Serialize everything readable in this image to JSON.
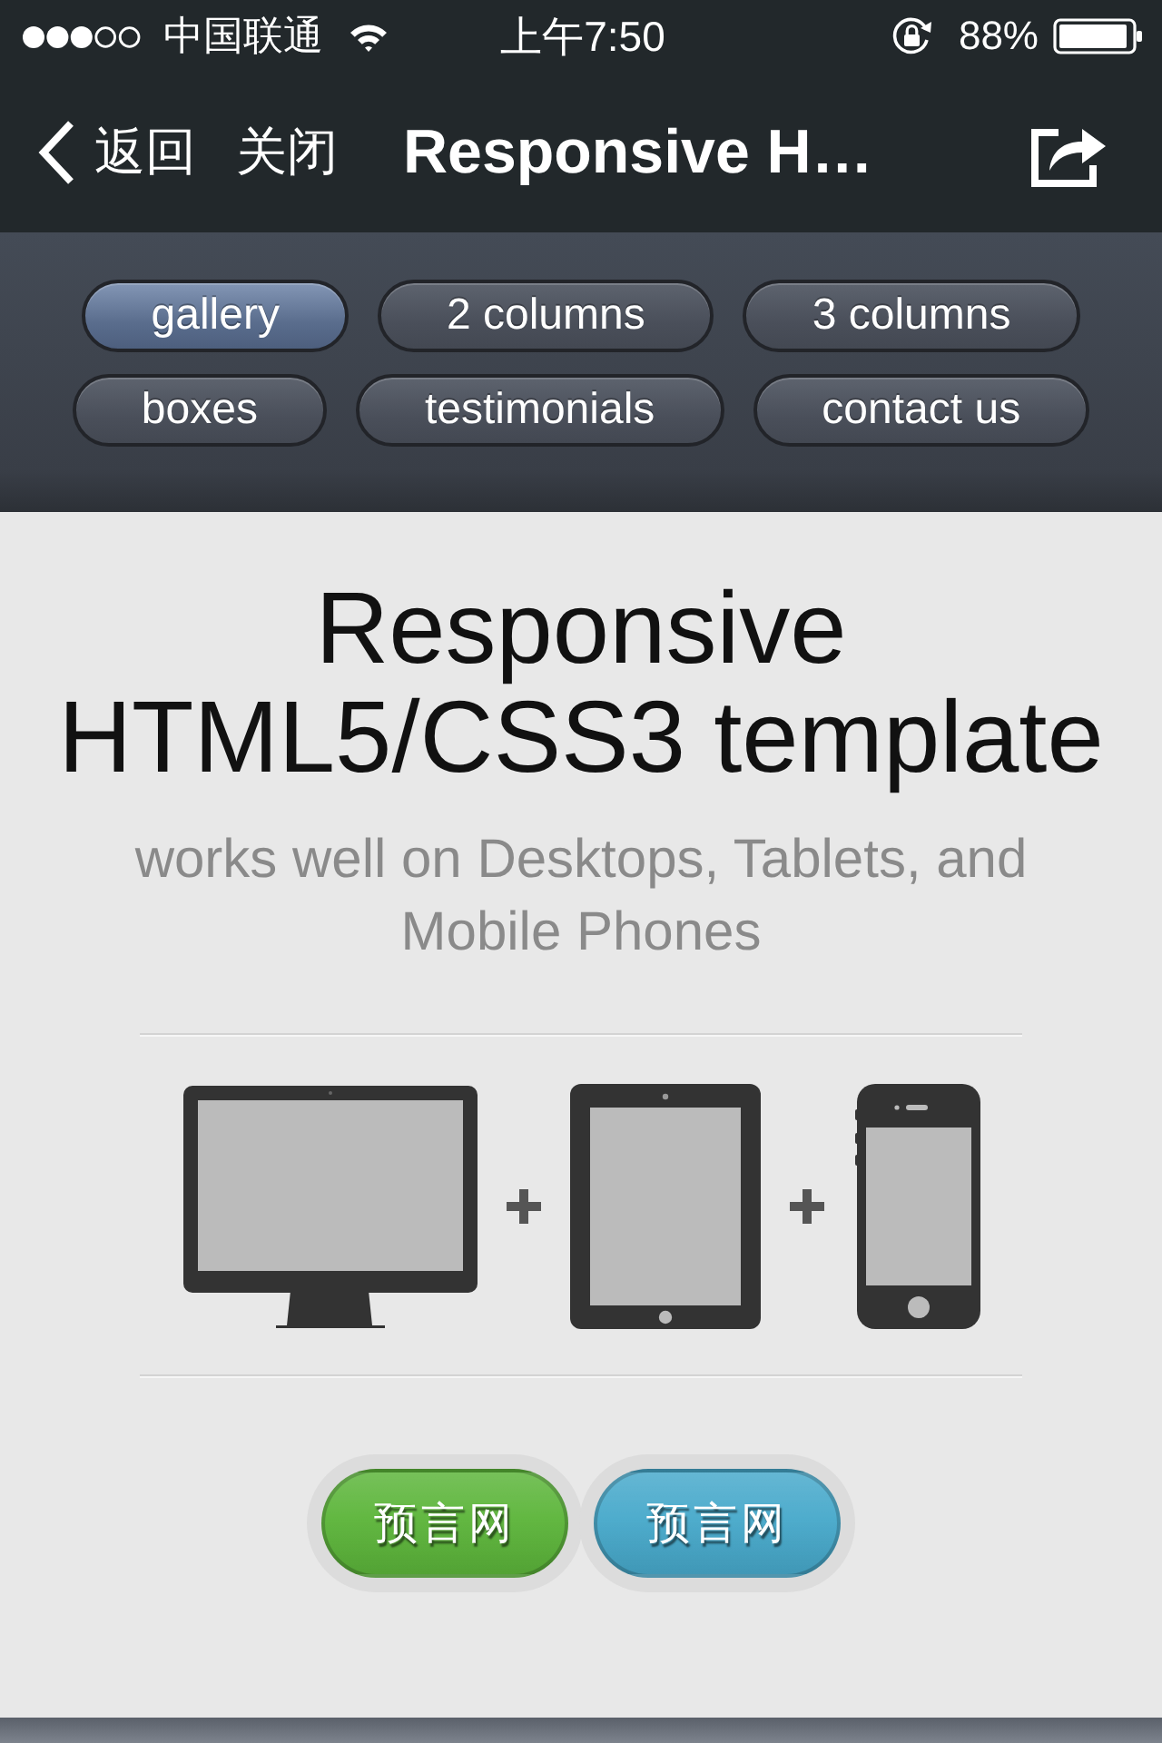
{
  "status_bar": {
    "carrier": "中国联通",
    "time": "上午7:50",
    "battery": "88%"
  },
  "nav_bar": {
    "back": "返回",
    "close": "关闭",
    "title": "Responsive H…"
  },
  "menu": [
    {
      "label": "gallery",
      "selected": true
    },
    {
      "label": "2 columns",
      "selected": false
    },
    {
      "label": "3 columns",
      "selected": false
    },
    {
      "label": "boxes",
      "selected": false
    },
    {
      "label": "testimonials",
      "selected": false
    },
    {
      "label": "contact us",
      "selected": false
    }
  ],
  "hero": {
    "title": "Responsive HTML5/CSS3 template",
    "subtitle": "works well on Desktops, Tablets, and Mobile Phones"
  },
  "buttons": [
    {
      "label": "预言网",
      "color": "#5cb53a"
    },
    {
      "label": "预言网",
      "color": "#47a9cb"
    }
  ]
}
